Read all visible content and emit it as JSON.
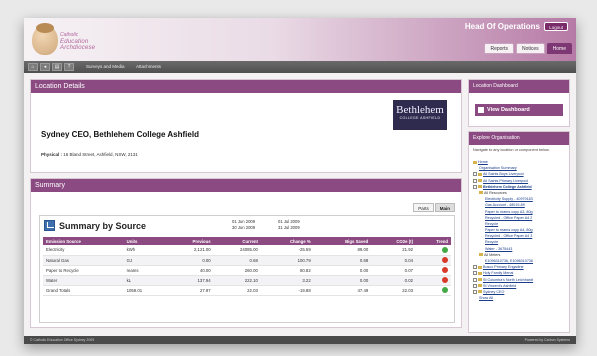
{
  "header": {
    "logo_line1": "Catholic",
    "logo_line2": "Education Archdiocese",
    "role_title": "Head Of Operations",
    "role_sub": "is currently logged in",
    "logout_label": "Logout",
    "buttons": [
      {
        "label": "Reports",
        "active": false
      },
      {
        "label": "Notices",
        "active": false
      },
      {
        "label": "Home",
        "active": true
      }
    ]
  },
  "navbar": {
    "icons": [
      "home-icon",
      "back-icon",
      "print-icon",
      "help-icon"
    ],
    "links": [
      "Surveys and Media",
      "Attachments"
    ]
  },
  "location": {
    "panel_title": "Location Details",
    "name": "Sydney CEO, Bethlehem College Ashfield",
    "physical_label": "Physical :",
    "physical_value": "16 Bland Street, Ashfield, NSW, 2131",
    "logo_text": "Bethlehem",
    "logo_subtext": "COLLEGE ASHFIELD"
  },
  "summary": {
    "panel_title": "Summary",
    "tabs": [
      {
        "label": "Parts",
        "active": false
      },
      {
        "label": "Main",
        "active": true
      }
    ],
    "box_title": "Summary by Source",
    "period_prev": [
      "01 Jun 2009",
      "30 Jun 2009"
    ],
    "period_curr": [
      "01 Jul 2009",
      "31 Jul 2009"
    ],
    "columns": [
      "Emission Source",
      "Units",
      "Previous",
      "Current",
      "Change %",
      "Bigs Saved",
      "CO2e (t)",
      "Trend"
    ],
    "rows": [
      {
        "source": "Electricity",
        "units": "kWh",
        "previous": "2,121.00",
        "current": "24085.00",
        "change": "-25.59",
        "saved": "89.00",
        "co2e": "21.92",
        "trend": "green"
      },
      {
        "source": "Natural Gas",
        "units": "GJ",
        "previous": "0.00",
        "current": "0.68",
        "change": "100.79",
        "saved": "0.68",
        "co2e": "0.04",
        "trend": "red"
      },
      {
        "source": "Paper to Recycle",
        "units": "reams",
        "previous": "40.00",
        "current": "260.00",
        "change": "80.82",
        "saved": "0.00",
        "co2e": "0.07",
        "trend": "red"
      },
      {
        "source": "Water",
        "units": "kL",
        "previous": "137.94",
        "current": "222.10",
        "change": "3.22",
        "saved": "0.00",
        "co2e": "0.02",
        "trend": "red"
      },
      {
        "source": "Grand Totals",
        "units": "1059.01",
        "previous": "27.97",
        "current": "22.03",
        "change": "-19.88",
        "saved": "47.49",
        "co2e": "22.03",
        "trend": "green"
      }
    ]
  },
  "sidebar": {
    "dashboard_title": "Location Dashboard",
    "view_dashboard_label": "View Dashboard",
    "org_title": "Explore Organisation",
    "org_intro": "Navigate to any location or component below.",
    "tree": [
      {
        "label": "Home",
        "level": 0,
        "type": "home"
      },
      {
        "label": "Organisation Summary",
        "level": 1,
        "type": "link"
      },
      {
        "label": "All Saints Boys Liverpool",
        "level": 0,
        "type": "node"
      },
      {
        "label": "All Saints Primary Liverpool",
        "level": 0,
        "type": "node"
      },
      {
        "label": "Bethlehem College Ashfield",
        "level": 0,
        "type": "node-open"
      },
      {
        "label": "All Resources",
        "level": 1,
        "type": "folder"
      },
      {
        "label": "Electricity Supply - 40979183",
        "level": 2,
        "type": "link"
      },
      {
        "label": "Gas Account - 48019-89",
        "level": 2,
        "type": "link"
      },
      {
        "label": "Paper to reams copy A3, 80g",
        "level": 2,
        "type": "link"
      },
      {
        "label": "Recycled - Office Paper A4 2",
        "level": 2,
        "type": "link"
      },
      {
        "label": "Recycle",
        "level": 2,
        "type": "link"
      },
      {
        "label": "Paper to reams copy A4, 80g",
        "level": 2,
        "type": "link"
      },
      {
        "label": "Recycled - Office Paper A4 3",
        "level": 2,
        "type": "link"
      },
      {
        "label": "Recycle",
        "level": 2,
        "type": "link"
      },
      {
        "label": "Water - 3675443",
        "level": 2,
        "type": "link"
      },
      {
        "label": "All Meters",
        "level": 1,
        "type": "folder"
      },
      {
        "label": "E1096310736, E1096310736",
        "level": 2,
        "type": "link"
      },
      {
        "label": "Bosco Primary Engadine",
        "level": 0,
        "type": "node"
      },
      {
        "label": "Holy Family Menai",
        "level": 0,
        "type": "node"
      },
      {
        "label": "St Columba's North Leichhardt",
        "level": 0,
        "type": "node"
      },
      {
        "label": "St Vincent's Ashfield",
        "level": 0,
        "type": "node"
      },
      {
        "label": "Sydney CEO",
        "level": 0,
        "type": "node"
      },
      {
        "label": "Show All",
        "level": 1,
        "type": "link"
      }
    ]
  },
  "footer": {
    "left": "© Catholic Education Office Sydney 2009",
    "right": "Powered by Carbon Systems"
  }
}
